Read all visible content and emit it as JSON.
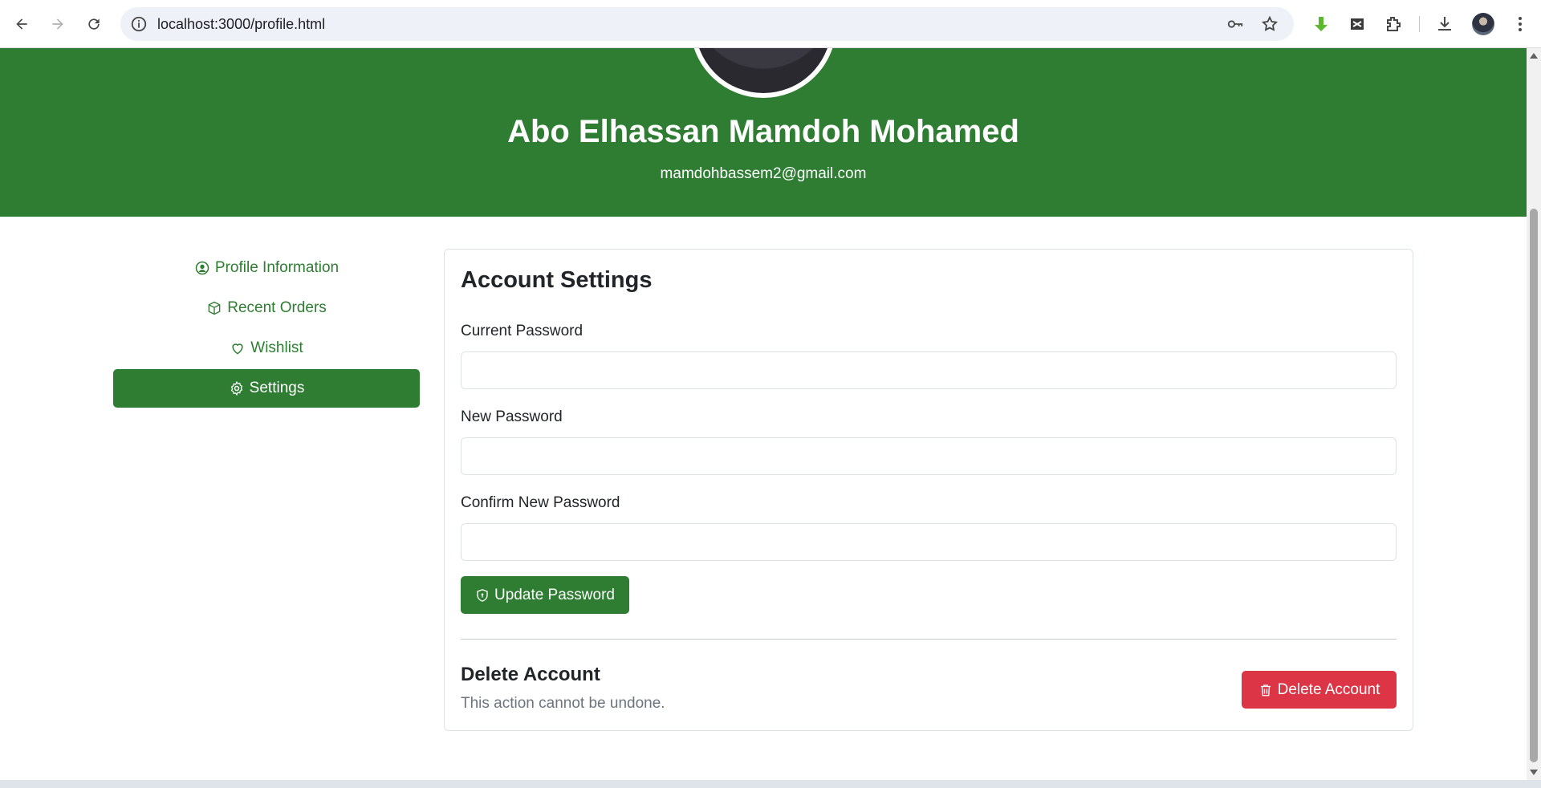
{
  "browser": {
    "url": "localhost:3000/profile.html"
  },
  "profile": {
    "name": "Abo Elhassan Mamdoh Mohamed",
    "email": "mamdohbassem2@gmail.com"
  },
  "sidebar": {
    "items": [
      {
        "label": "Profile Information",
        "icon": "person-circle-icon"
      },
      {
        "label": "Recent Orders",
        "icon": "box-icon"
      },
      {
        "label": "Wishlist",
        "icon": "heart-icon"
      },
      {
        "label": "Settings",
        "icon": "gear-icon",
        "active": true
      }
    ]
  },
  "settings": {
    "title": "Account Settings",
    "current_password_label": "Current Password",
    "current_password_value": "",
    "new_password_label": "New Password",
    "new_password_value": "",
    "confirm_password_label": "Confirm New Password",
    "confirm_password_value": "",
    "update_button_label": "Update Password",
    "delete_title": "Delete Account",
    "delete_text": "This action cannot be undone.",
    "delete_button_label": "Delete Account"
  },
  "colors": {
    "brand_green": "#2e7d32",
    "danger_red": "#dc3545",
    "muted_text": "#6c757d"
  }
}
